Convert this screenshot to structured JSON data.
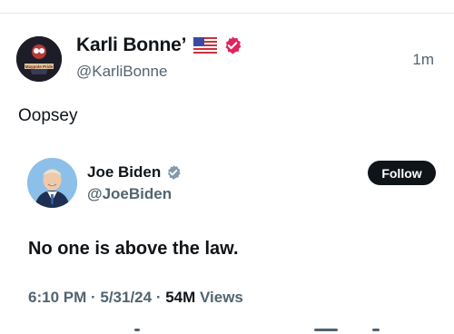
{
  "author": {
    "display_name": "Karli Bonne’",
    "handle": "@KarliBonne",
    "flag_icon": "us-flag-icon",
    "badge_icon": "pink-verified-badge-icon",
    "badge_color": "#e0245e",
    "avatar_text": "Maypole Pride"
  },
  "tweet": {
    "time_ago": "1m",
    "text": "Oopsey"
  },
  "quoted": {
    "display_name": "Joe Biden",
    "handle": "@JoeBiden",
    "badge_icon": "gray-verified-badge-icon",
    "badge_color": "#829aab",
    "follow_label": "Follow",
    "text": "No one is above the law.",
    "time": "6:10 PM",
    "sep1": " · ",
    "date": "5/31/24",
    "sep2": " · ",
    "views_count": "54M",
    "views_label": " Views"
  }
}
